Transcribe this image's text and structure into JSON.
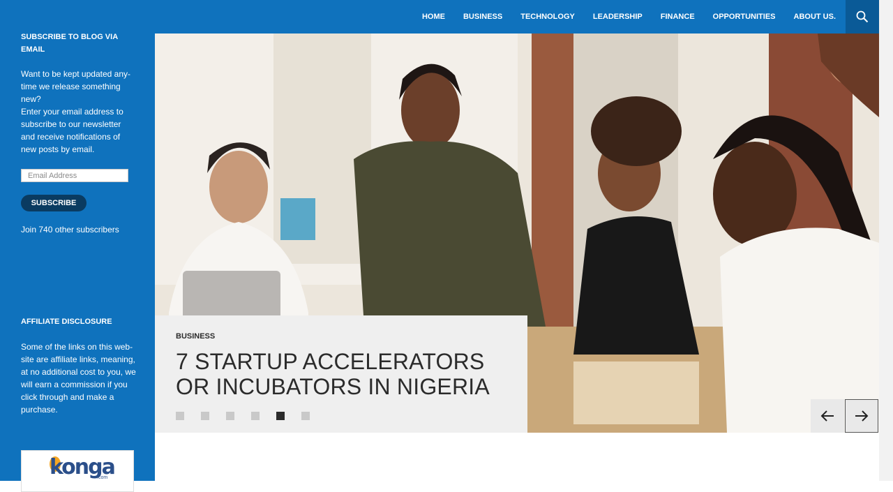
{
  "sidebar": {
    "subscribe_heading": "SUBSCRIBE TO BLOG VIA EMAIL",
    "subscribe_text_1": "Want to be kept updated any-time we release something new?",
    "subscribe_text_2": "Enter your email address to subscribe to our newsletter and receive notifications of new posts by email.",
    "email_placeholder": "Email Address",
    "subscribe_button": "SUBSCRIBE",
    "subscribers_text": "Join 740 other subscribers",
    "disclosure_heading": "AFFILIATE DISCLOSURE",
    "disclosure_text": "Some of the links on this web-site are affiliate links, meaning, at no additional cost to you, we will earn a commission if you click through and make a purchase.",
    "ad_logo": "konga",
    "ad_logo_suffix": ".com"
  },
  "nav": {
    "items": [
      "HOME",
      "BUSINESS",
      "TECHNOLOGY",
      "LEADERSHIP",
      "FINANCE",
      "OPPORTUNITIES",
      "ABOUT US."
    ],
    "active": "HOME",
    "search_icon": "search-icon"
  },
  "slider": {
    "category": "BUSINESS",
    "title": "7 STARTUP ACCELERATORS OR INCUBATORS IN NIGERIA",
    "slide_count": 6,
    "active_slide": 5,
    "prev_icon": "arrow-left-icon",
    "next_icon": "arrow-right-icon"
  },
  "colors": {
    "brand_blue": "#0f72bd",
    "dark_button": "#0a3b61",
    "caption_bg": "#efefef"
  }
}
